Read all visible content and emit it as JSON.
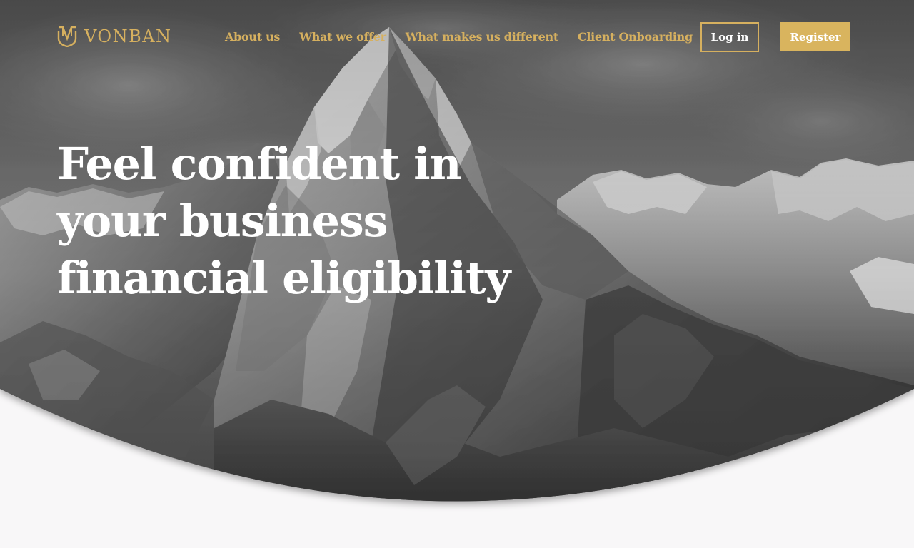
{
  "brand": {
    "name": "VONBAN",
    "logo_icon": "vonban-shield-logo",
    "accent_color": "#d6b05f"
  },
  "nav": {
    "items": [
      {
        "label": "About us"
      },
      {
        "label": "What we offer"
      },
      {
        "label": "What makes us different"
      },
      {
        "label": "Client Onboarding"
      }
    ]
  },
  "auth": {
    "login_label": "Log in",
    "register_label": "Register"
  },
  "hero": {
    "headline_line1": "Feel confident in",
    "headline_line2": "your business",
    "headline_line3": "financial eligibility",
    "background": "mountain-landscape-grayscale"
  }
}
